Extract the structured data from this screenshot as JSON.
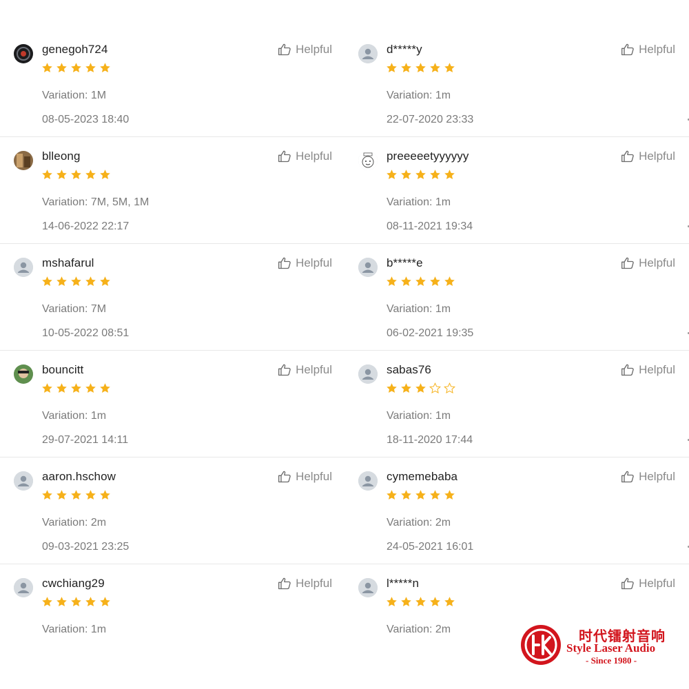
{
  "helpful_label": "Helpful",
  "colors": {
    "star": "#f6b11a",
    "text_muted": "#7a7a7a",
    "logo_red": "#d2151d"
  },
  "reviews_left": [
    {
      "username": "genegoh724",
      "rating": 5,
      "variation": "Variation: 1M",
      "datetime": "08-05-2023 18:40",
      "avatar": "photo-dark"
    },
    {
      "username": "blleong",
      "rating": 5,
      "variation": "Variation: 7M, 5M, 1M",
      "datetime": "14-06-2022 22:17",
      "avatar": "photo-brown"
    },
    {
      "username": "mshafarul",
      "rating": 5,
      "variation": "Variation: 7M",
      "datetime": "10-05-2022 08:51",
      "avatar": "default"
    },
    {
      "username": "bouncitt",
      "rating": 5,
      "variation": "Variation: 1m",
      "datetime": "29-07-2021 14:11",
      "avatar": "photo-green"
    },
    {
      "username": "aaron.hschow",
      "rating": 5,
      "variation": "Variation: 2m",
      "datetime": "09-03-2021 23:25",
      "avatar": "default"
    },
    {
      "username": "cwchiang29",
      "rating": 5,
      "variation": "Variation: 1m",
      "datetime": "",
      "avatar": "default"
    }
  ],
  "reviews_right": [
    {
      "username": "d*****y",
      "rating": 5,
      "variation": "Variation: 1m",
      "datetime": "22-07-2020 23:33",
      "avatar": "default"
    },
    {
      "username": "preeeeetyyyyyy",
      "rating": 5,
      "variation": "Variation: 1m",
      "datetime": "08-11-2021 19:34",
      "avatar": "cartoon"
    },
    {
      "username": "b*****e",
      "rating": 5,
      "variation": "Variation: 1m",
      "datetime": "06-02-2021 19:35",
      "avatar": "default"
    },
    {
      "username": "sabas76",
      "rating": 3,
      "variation": "Variation: 1m",
      "datetime": "18-11-2020 17:44",
      "avatar": "default"
    },
    {
      "username": "cymemebaba",
      "rating": 5,
      "variation": "Variation: 2m",
      "datetime": "24-05-2021 16:01",
      "avatar": "default"
    },
    {
      "username": "l*****n",
      "rating": 5,
      "variation": "Variation: 2m",
      "datetime": "",
      "avatar": "default"
    }
  ],
  "logo": {
    "chinese": "时代镭射音响",
    "english": "Style Laser Audio",
    "since": "- Since 1980 -"
  }
}
